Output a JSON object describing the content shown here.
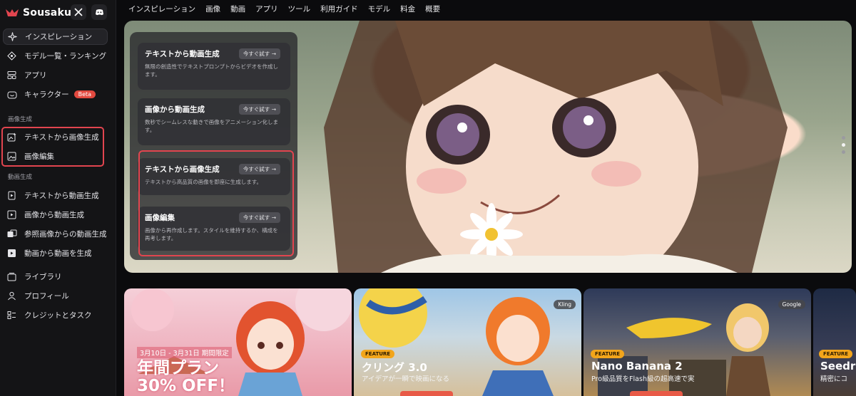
{
  "brand": {
    "name": "Sousaku"
  },
  "sidebar": {
    "main_items": [
      {
        "label": "インスピレーション",
        "icon": "sparkle-icon"
      },
      {
        "label": "モデル一覧・ランキング",
        "icon": "models-icon"
      },
      {
        "label": "アプリ",
        "icon": "apps-icon"
      },
      {
        "label": "キャラクター",
        "icon": "character-icon",
        "badge": "Beta"
      }
    ],
    "image_section": {
      "label": "画像生成",
      "items": [
        {
          "label": "テキストから画像生成",
          "icon": "text-to-image-icon"
        },
        {
          "label": "画像編集",
          "icon": "image-edit-icon"
        }
      ]
    },
    "video_section": {
      "label": "動画生成",
      "items": [
        {
          "label": "テキストから動画生成",
          "icon": "text-to-video-icon"
        },
        {
          "label": "画像から動画生成",
          "icon": "image-to-video-icon"
        },
        {
          "label": "参照画像からの動画生成",
          "icon": "reference-video-icon"
        },
        {
          "label": "動画から動画を生成",
          "icon": "video-to-video-icon"
        }
      ]
    },
    "bottom_items": [
      {
        "label": "ライブラリ",
        "icon": "library-icon"
      },
      {
        "label": "プロフィール",
        "icon": "profile-icon"
      },
      {
        "label": "クレジットとタスク",
        "icon": "credits-icon"
      }
    ]
  },
  "topnav": [
    "インスピレーション",
    "画像",
    "動画",
    "アプリ",
    "ツール",
    "利用ガイド",
    "モデル",
    "料金",
    "概要"
  ],
  "hero": {
    "cards": [
      {
        "title": "テキストから動画生成",
        "button": "今すぐ試す",
        "desc": "無限の創造性でテキストプロンプトからビデオを作成します。"
      },
      {
        "title": "画像から動画生成",
        "button": "今すぐ試す",
        "desc": "数秒でシームレスな動きで画像をアニメーション化します。"
      },
      {
        "title": "テキストから画像生成",
        "button": "今すぐ試す",
        "desc": "テキストから高品質の画像を即座に生成します。"
      },
      {
        "title": "画像編集",
        "button": "今すぐ試す",
        "desc": "画像から再作成します。スタイルを維持するか、構成を再考します。"
      }
    ]
  },
  "tiles": {
    "promo": {
      "date": "3月10日 - 3月31日 期間限定",
      "headline1": "年間プラン",
      "headline2": "30% OFF！"
    },
    "kling": {
      "tag": "Kling",
      "feature": "FEATURE",
      "title": "クリング 3.0",
      "sub": "アイデアが一瞬で映画になる"
    },
    "nano": {
      "tag": "Google",
      "feature": "FEATURE",
      "title": "Nano Banana 2",
      "sub": "Pro級品質をFlash級の超高速で実"
    },
    "seed": {
      "feature": "FEATURE",
      "title": "Seedr",
      "sub": "精密にコ"
    }
  },
  "colors": {
    "accent": "#e2454f",
    "feature": "#f2a51b",
    "beta": "#e2493f"
  }
}
